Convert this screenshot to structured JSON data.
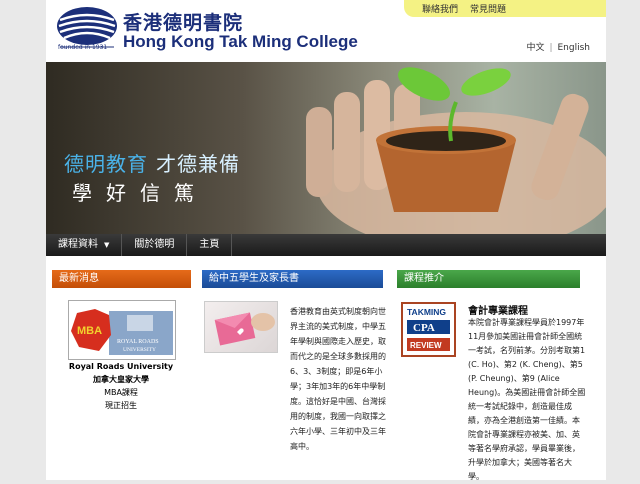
{
  "header": {
    "cn_name": "香港德明書院",
    "en_name": "Hong Kong Tak Ming College",
    "founded": "founded in 1931",
    "toplinks": [
      "聯絡我們",
      "常見問題"
    ],
    "lang": {
      "zh": "中文",
      "en": "English"
    }
  },
  "banner": {
    "line1_a": "德明教育",
    "line1_b": "才德兼備",
    "line2": "學好信篤"
  },
  "nav": [
    {
      "label": "課程資料",
      "has_dropdown": true
    },
    {
      "label": "關於德明"
    },
    {
      "label": "主頁"
    }
  ],
  "columns": {
    "news": {
      "heading": "最新消息",
      "logo_text": {
        "mba": "MBA",
        "school_line1": "ROYAL ROADS",
        "school_line2": "UNIVERSITY"
      },
      "lines": [
        "Royal Roads University",
        "加拿大皇家大學",
        "MBA課程",
        "現正招生"
      ]
    },
    "letter": {
      "heading": "給中五學生及家長書",
      "body": "香港教育由英式制度朝向世界主流的美式制度，中學五年學制與國際走入歷史，取而代之的是全球多數採用的6、3、3制度；即是6年小學；3年加3年的6年中學制度。這恰好是中國、台灣採用的制度，我國一向取擇之六年小學、三年初中及三年高中。"
    },
    "courses": {
      "heading": "課程推介",
      "badge": {
        "top": "TAKMING",
        "mid": "CPA",
        "bottom": "REVIEW"
      },
      "title": "會計專業課程",
      "body": "本院會計專業課程學員於1997年11月參加美國註冊會計師全國統一考試，名列前茅。分別考取第1 (C. Ho)、第2 (K. Cheng)、第5 (P. Cheung)、第9 (Alice Heung)。為美國註冊會計師全國統一考試紀錄中，創造最佳成績，亦為全港創造第一佳績。本院會計專業課程亦被美、加、英等著名學府承認，學員畢業後，升學於加拿大；美國等著名大學。"
    }
  },
  "colors": {
    "brand_blue": "#1c2f7a",
    "orange": "#d95b10",
    "blue": "#2458aa",
    "green": "#3a963a"
  }
}
